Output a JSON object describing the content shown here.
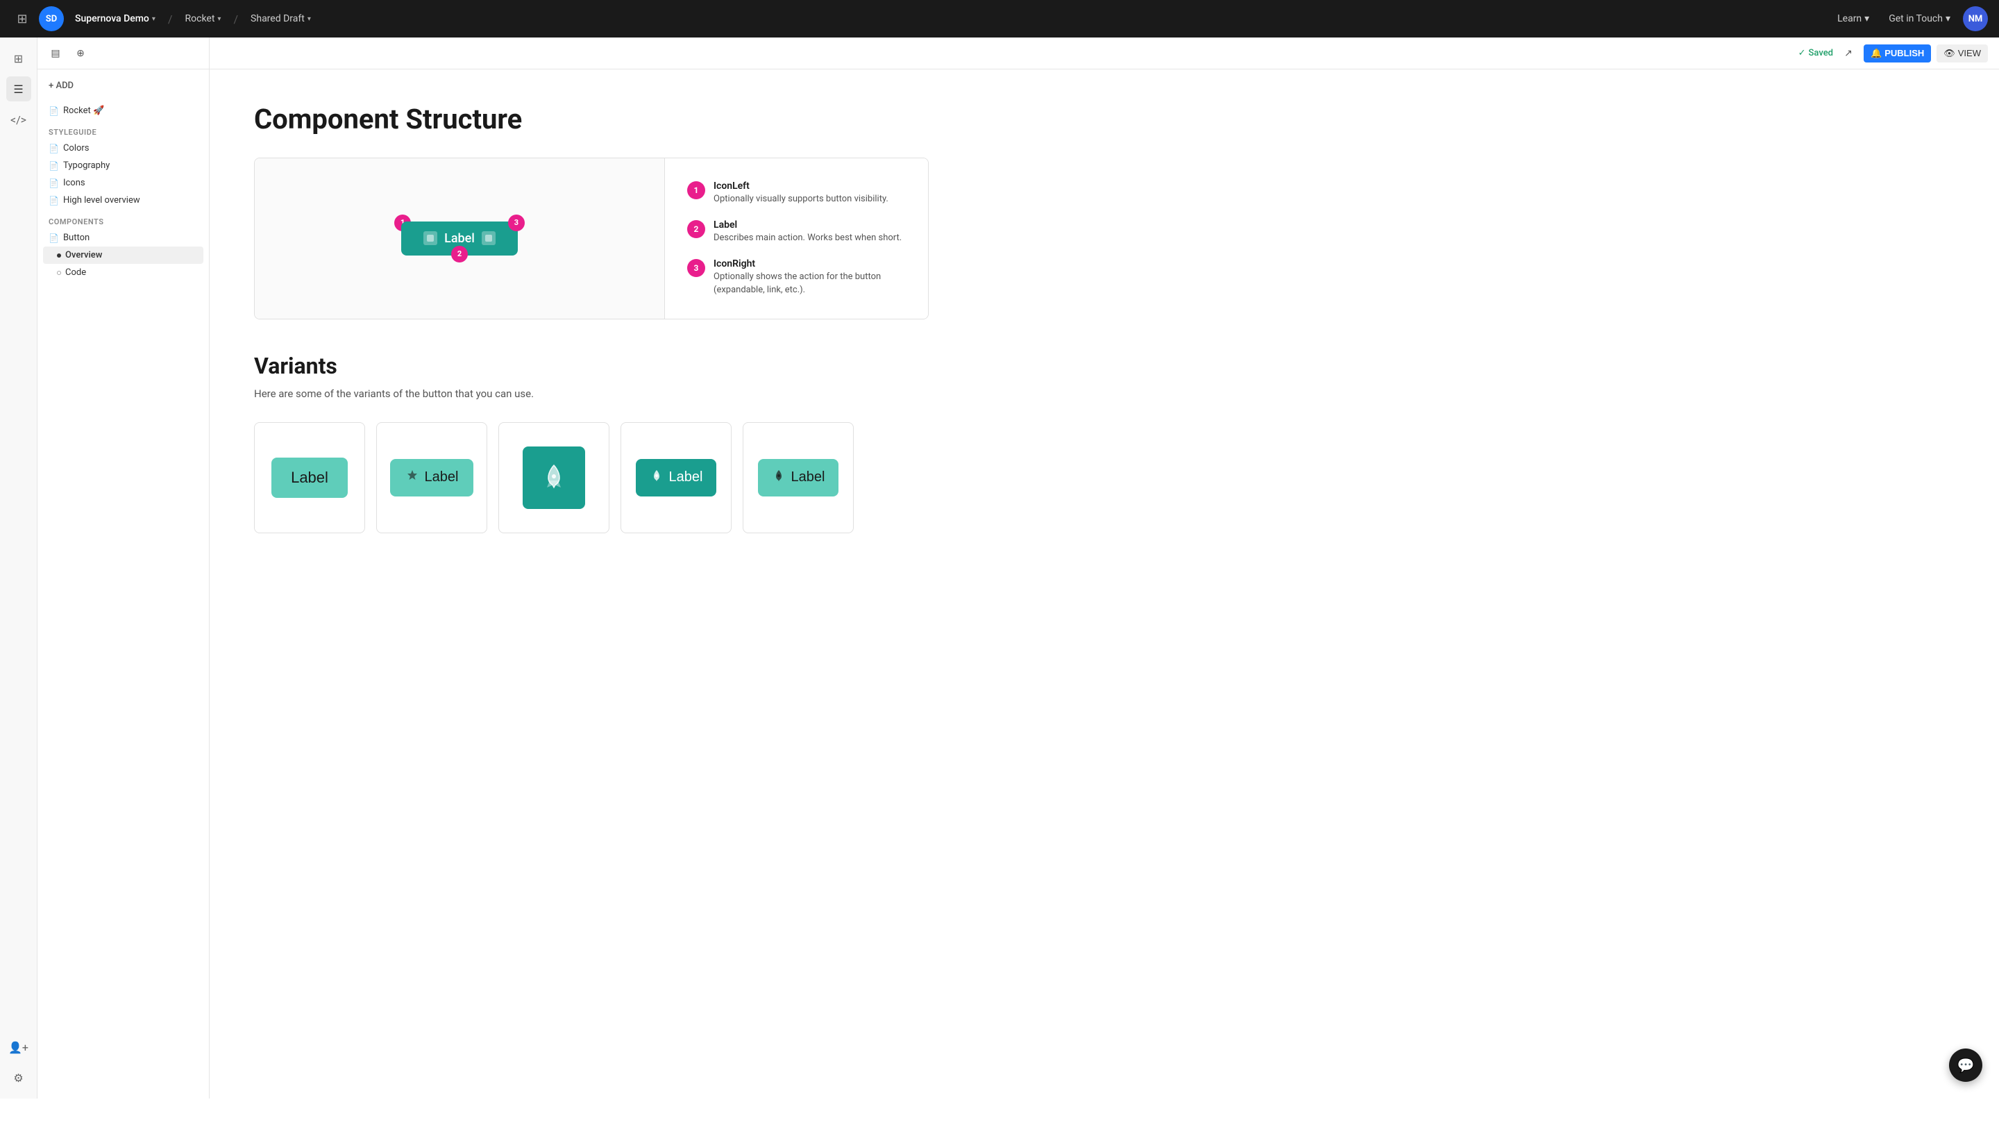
{
  "topnav": {
    "logo_initials": "SD",
    "brand_name": "Supernova Demo",
    "project_name": "Rocket",
    "draft_label": "Shared Draft",
    "learn_label": "Learn",
    "contact_label": "Get in Touch",
    "avatar_initials": "NM"
  },
  "left_panel": {
    "add_label": "+ ADD",
    "root_item_label": "Rocket 🚀",
    "styleguide_label": "STYLEGUIDE",
    "styleguide_items": [
      {
        "label": "Colors"
      },
      {
        "label": "Typography"
      },
      {
        "label": "Icons"
      },
      {
        "label": "High level overview"
      }
    ],
    "components_label": "COMPONENTS",
    "component_items": [
      {
        "label": "Button"
      }
    ],
    "button_sub_items": [
      {
        "label": "Overview",
        "active": true
      },
      {
        "label": "Code",
        "active": false
      }
    ]
  },
  "toolbar": {
    "saved_label": "Saved",
    "publish_label": "PUBLISH",
    "view_label": "VIEW"
  },
  "main": {
    "page_title": "Component Structure",
    "diagram": {
      "button_label": "Label",
      "callout_1": "1",
      "callout_2": "2",
      "callout_3": "3",
      "items": [
        {
          "badge": "1",
          "title": "IconLeft",
          "desc": "Optionally visually supports button visibility."
        },
        {
          "badge": "2",
          "title": "Label",
          "desc": "Describes main action. Works best when short."
        },
        {
          "badge": "3",
          "title": "IconRight",
          "desc": "Optionally shows the action for the button (expandable, link, etc.)."
        }
      ]
    },
    "variants_title": "Variants",
    "variants_desc": "Here are some of the variants of the button that you can use.",
    "variant_labels": [
      "Label",
      "Label",
      "",
      "Label",
      "Label"
    ]
  }
}
